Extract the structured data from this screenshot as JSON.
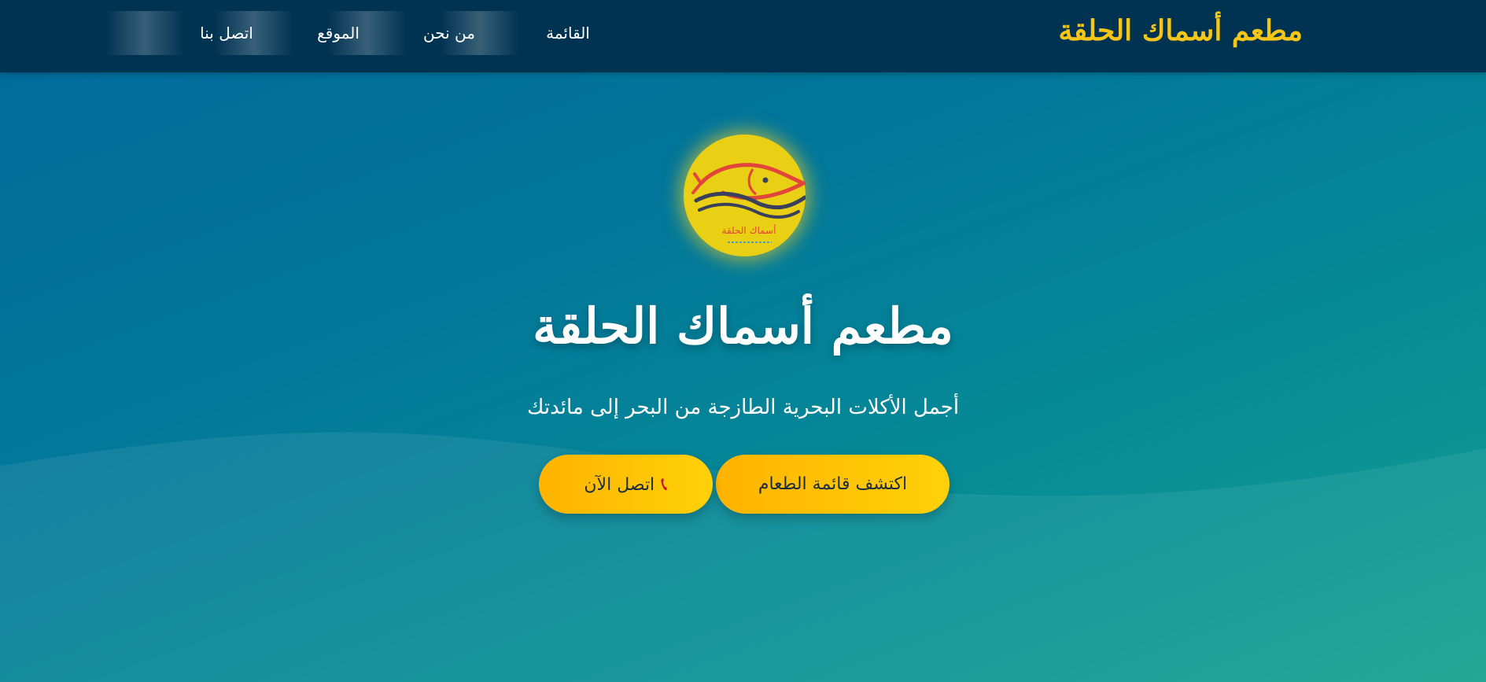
{
  "header": {
    "brand": "مطعم أسماك الحلقة",
    "nav": {
      "menu": "القائمة",
      "about": "من نحن",
      "location": "الموقع",
      "contact": "اتصل بنا"
    }
  },
  "hero": {
    "logo_text": "أسماك الحلقة",
    "title": "مطعم أسماك الحلقة",
    "subtitle": "أجمل الأكلات البحرية الطازجة من البحر إلى مائدتك",
    "buttons": {
      "menu": "اكتشف قائمة الطعام",
      "call": "اتصل الآن"
    },
    "call_icon": "phone-icon"
  },
  "colors": {
    "header_bg": "#003352",
    "brand": "#f5c518",
    "button_start": "#ffb300",
    "button_end": "#ffd10a",
    "logo_bg": "#e9d015"
  }
}
